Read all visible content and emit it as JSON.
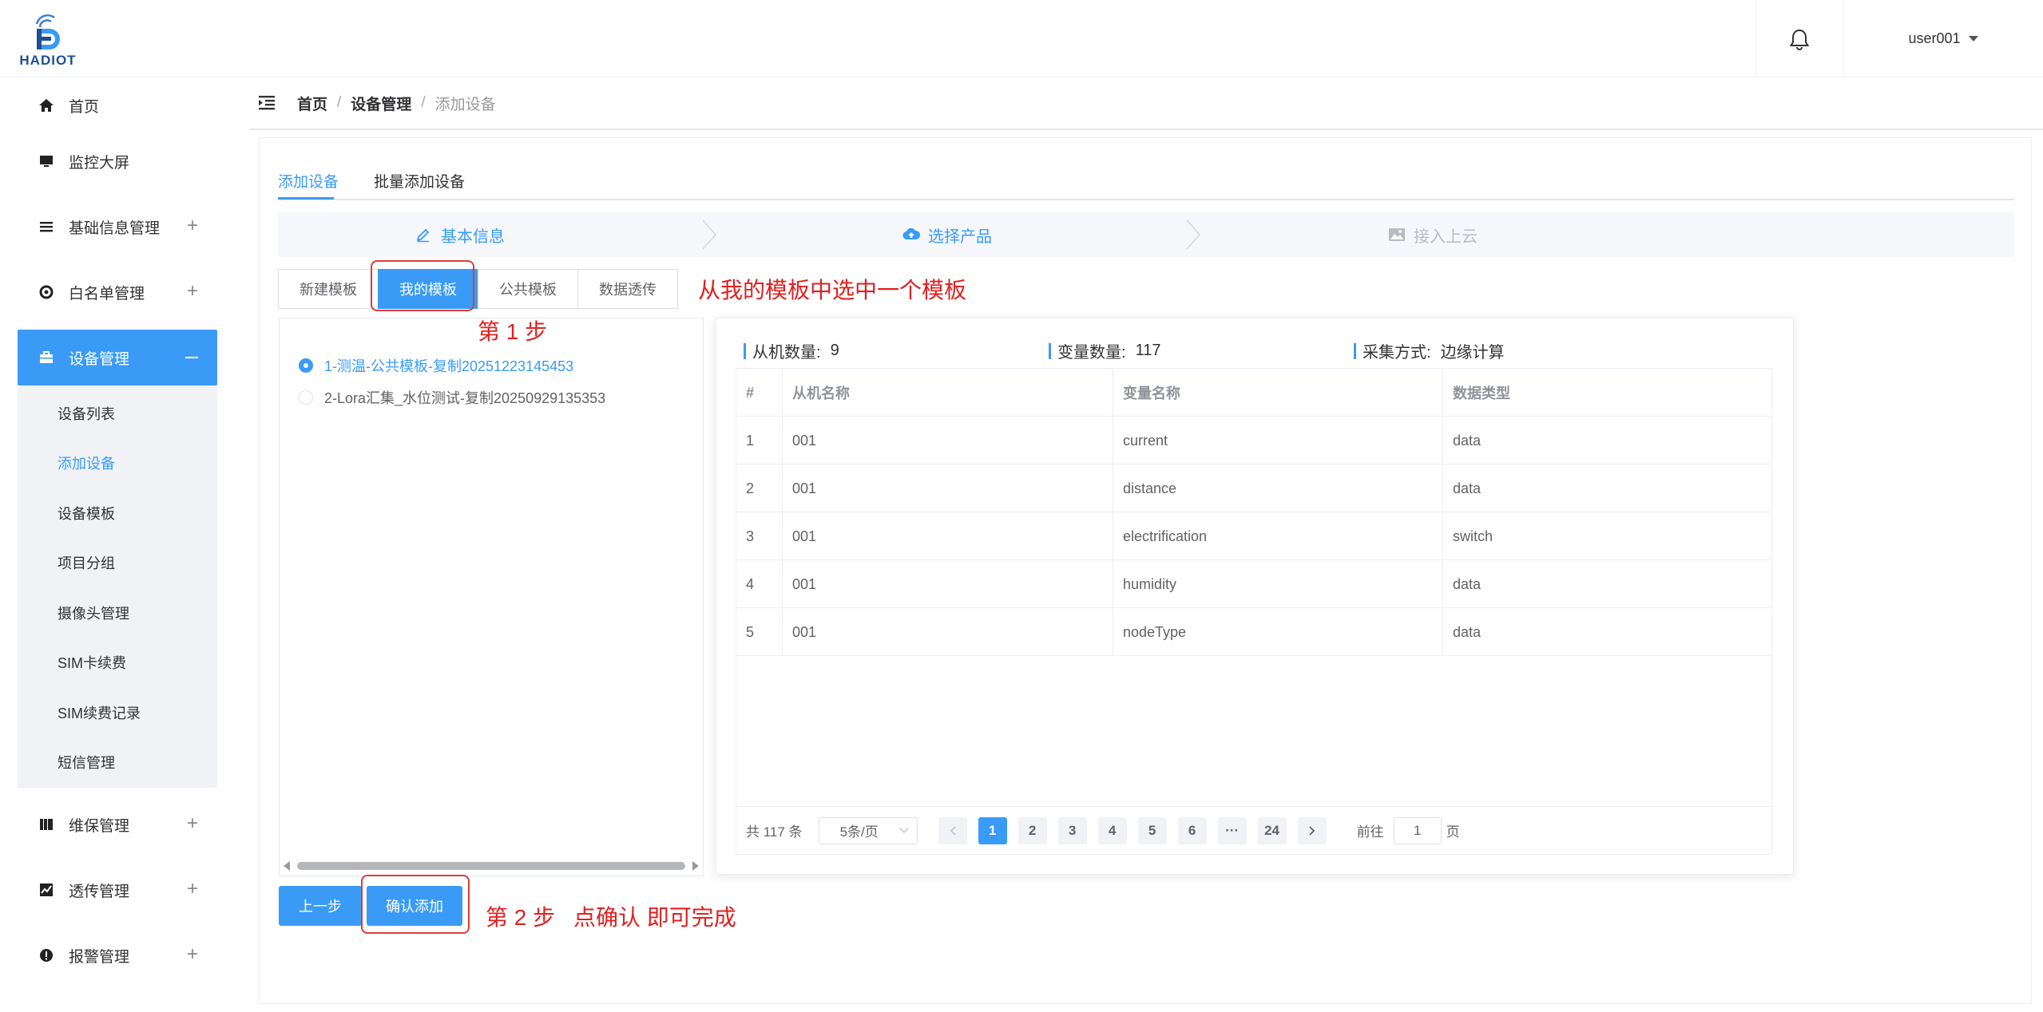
{
  "header": {
    "logo_text": "HADIOT",
    "user": "user001"
  },
  "sidebar": {
    "items": [
      {
        "label": "首页",
        "icon": "home-icon"
      },
      {
        "label": "监控大屏",
        "icon": "monitor-icon"
      },
      {
        "label": "基础信息管理",
        "icon": "list-icon"
      },
      {
        "label": "白名单管理",
        "icon": "crosshair-icon"
      },
      {
        "label": "设备管理",
        "icon": "briefcase-icon"
      },
      {
        "label": "维保管理",
        "icon": "book-icon"
      },
      {
        "label": "透传管理",
        "icon": "chart-icon"
      },
      {
        "label": "报警管理",
        "icon": "alert-icon"
      }
    ],
    "submenu": [
      "设备列表",
      "添加设备",
      "设备模板",
      "项目分组",
      "摄像头管理",
      "SIM卡续费",
      "SIM续费记录",
      "短信管理"
    ]
  },
  "breadcrumb": [
    "首页",
    "设备管理",
    "添加设备"
  ],
  "tabs": [
    "添加设备",
    "批量添加设备"
  ],
  "steps": [
    "基本信息",
    "选择产品",
    "接入上云"
  ],
  "template_buttons": [
    "新建模板",
    "我的模板",
    "公共模板",
    "数据透传"
  ],
  "annotations": {
    "hint": "从我的模板中选中一个模板",
    "step1": "第 1 步",
    "step2": "第 2 步",
    "step2_hint": "点确认 即可完成"
  },
  "templates": [
    "1-测温-公共模板-复制20251223145453",
    "2-Lora汇集_水位测试-复制20250929135353"
  ],
  "stats": {
    "slave_label": "从机数量:",
    "slave_value": "9",
    "var_label": "变量数量:",
    "var_value": "117",
    "mode_label": "采集方式:",
    "mode_value": "边缘计算"
  },
  "table": {
    "headers": [
      "#",
      "从机名称",
      "变量名称",
      "数据类型"
    ],
    "rows": [
      [
        "1",
        "001",
        "current",
        "data"
      ],
      [
        "2",
        "001",
        "distance",
        "data"
      ],
      [
        "3",
        "001",
        "electrification",
        "switch"
      ],
      [
        "4",
        "001",
        "humidity",
        "data"
      ],
      [
        "5",
        "001",
        "nodeType",
        "data"
      ]
    ]
  },
  "pagination": {
    "total": "共 117 条",
    "page_size": "5条/页",
    "pages": [
      "1",
      "2",
      "3",
      "4",
      "5",
      "6",
      "···",
      "24"
    ],
    "goto_label": "前往",
    "goto_value": "1",
    "goto_suffix": "页"
  },
  "buttons": {
    "prev": "上一步",
    "confirm": "确认添加"
  },
  "colors": {
    "primary": "#3a9bf7",
    "annotation_red": "#e02020",
    "disabled": "#b8bcc2"
  }
}
